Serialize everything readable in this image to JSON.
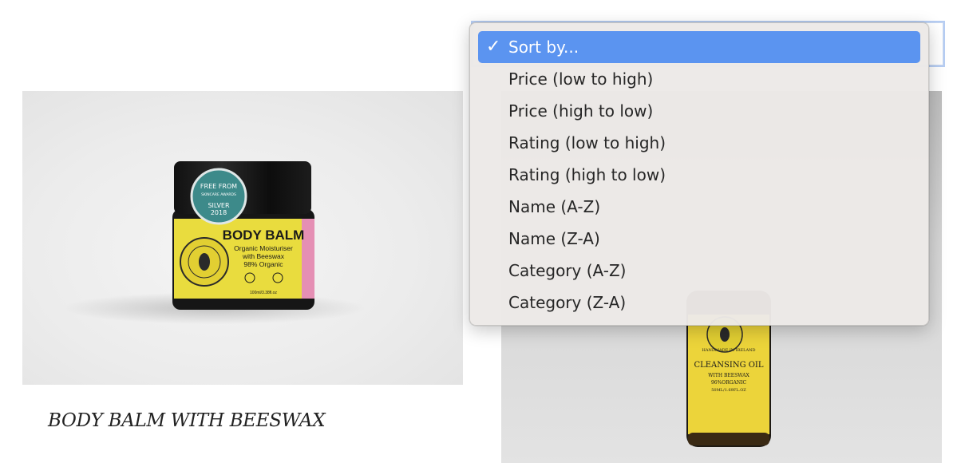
{
  "sort": {
    "options": [
      {
        "label": "Sort by...",
        "selected": true
      },
      {
        "label": "Price (low to high)",
        "selected": false
      },
      {
        "label": "Price (high to low)",
        "selected": false
      },
      {
        "label": "Rating (low to high)",
        "selected": false
      },
      {
        "label": "Rating (high to low)",
        "selected": false
      },
      {
        "label": "Name (A-Z)",
        "selected": false
      },
      {
        "label": "Name (Z-A)",
        "selected": false
      },
      {
        "label": "Category (A-Z)",
        "selected": false
      },
      {
        "label": "Category (Z-A)",
        "selected": false
      }
    ],
    "check_glyph": "✓",
    "selected_color": "#5b94f0"
  },
  "products": [
    {
      "title": "BODY BALM WITH BEESWAX",
      "label_text": {
        "badge_line1": "FREE FROM",
        "badge_line2": "SKINCARE AWARDS",
        "badge_line3": "SILVER",
        "badge_line4": "2018",
        "name": "BODY BALM",
        "subtitle1": "Organic Moisturiser",
        "subtitle2": "with Beeswax",
        "subtitle3": "98% Organic",
        "ring_text": "HANDMADE IN IRELAND",
        "size": "100ml/3.38fl.oz"
      }
    },
    {
      "title": "",
      "label_text": {
        "ring_text": "HANDMADE IN IRELAND",
        "name": "CLEANSING OIL",
        "subtitle1": "WITH BEESWAX",
        "subtitle2": "96%ORGANIC",
        "size": "50ML/1.69FL.OZ"
      }
    }
  ]
}
